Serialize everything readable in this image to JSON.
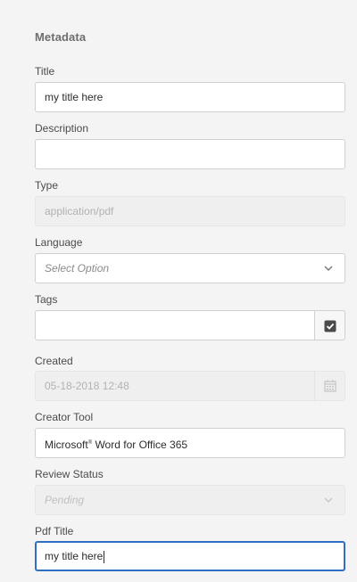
{
  "section": {
    "title": "Metadata"
  },
  "fields": {
    "title": {
      "label": "Title",
      "value": "my title here"
    },
    "description": {
      "label": "Description",
      "value": ""
    },
    "type": {
      "label": "Type",
      "value": "application/pdf"
    },
    "language": {
      "label": "Language",
      "placeholder": "Select Option"
    },
    "tags": {
      "label": "Tags",
      "value": ""
    },
    "created": {
      "label": "Created",
      "value": "05-18-2018 12:48"
    },
    "creator_tool": {
      "label": "Creator Tool",
      "value_prefix": "Microsoft",
      "value_mark": "®",
      "value_suffix": " Word for Office 365"
    },
    "review_status": {
      "label": "Review Status",
      "placeholder": "Pending"
    },
    "pdf_title": {
      "label": "Pdf Title",
      "value": "my title here"
    }
  },
  "icons": {
    "language_dropdown": "chevron-down-icon",
    "tags_picker": "checkbox-icon",
    "created_picker": "calendar-icon",
    "review_dropdown": "chevron-down-icon"
  },
  "colors": {
    "focus": "#326ec8",
    "background": "#f4f4f4"
  }
}
